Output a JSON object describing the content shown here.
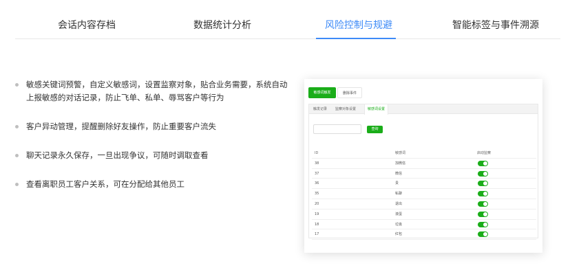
{
  "tabs": [
    {
      "label": "会话内容存档",
      "active": false
    },
    {
      "label": "数据统计分析",
      "active": false
    },
    {
      "label": "风险控制与规避",
      "active": true
    },
    {
      "label": "智能标签与事件溯源",
      "active": false
    }
  ],
  "features": [
    "敏感关键词预警，自定义敏感词，设置监察对象，贴合业务需要，系统自动上报敏感的对话记录，防止飞单、私单、辱骂客户等行为",
    "客户异动管理，提醒删除好友操作，防止重要客户流失",
    "聊天记录永久保存，一旦出现争议，可随时调取查看",
    "查看离职员工客户关系，可在分配给其他员工"
  ],
  "mock": {
    "buttons": {
      "primary": "敏感词触发",
      "secondary": "删除事件"
    },
    "subtabs": [
      "触发记录",
      "监察对象设置",
      "敏感词设置"
    ],
    "active_subtab": 2,
    "search": {
      "value": "",
      "placeholder": "",
      "button": "查询"
    },
    "table": {
      "headers": {
        "id": "ID",
        "word": "敏感词",
        "monitor": "启动监察"
      },
      "rows": [
        {
          "id": "38",
          "word": "加微信",
          "on": true
        },
        {
          "id": "37",
          "word": "微信",
          "on": true
        },
        {
          "id": "36",
          "word": "贵",
          "on": true
        },
        {
          "id": "35",
          "word": "私聊",
          "on": true
        },
        {
          "id": "20",
          "word": "退出",
          "on": true
        },
        {
          "id": "19",
          "word": "滚蛋",
          "on": true
        },
        {
          "id": "18",
          "word": "垃圾",
          "on": true
        },
        {
          "id": "17",
          "word": "红包",
          "on": true
        }
      ]
    }
  },
  "colors": {
    "accent_blue": "#3d8af7",
    "accent_green": "#1aad19"
  }
}
